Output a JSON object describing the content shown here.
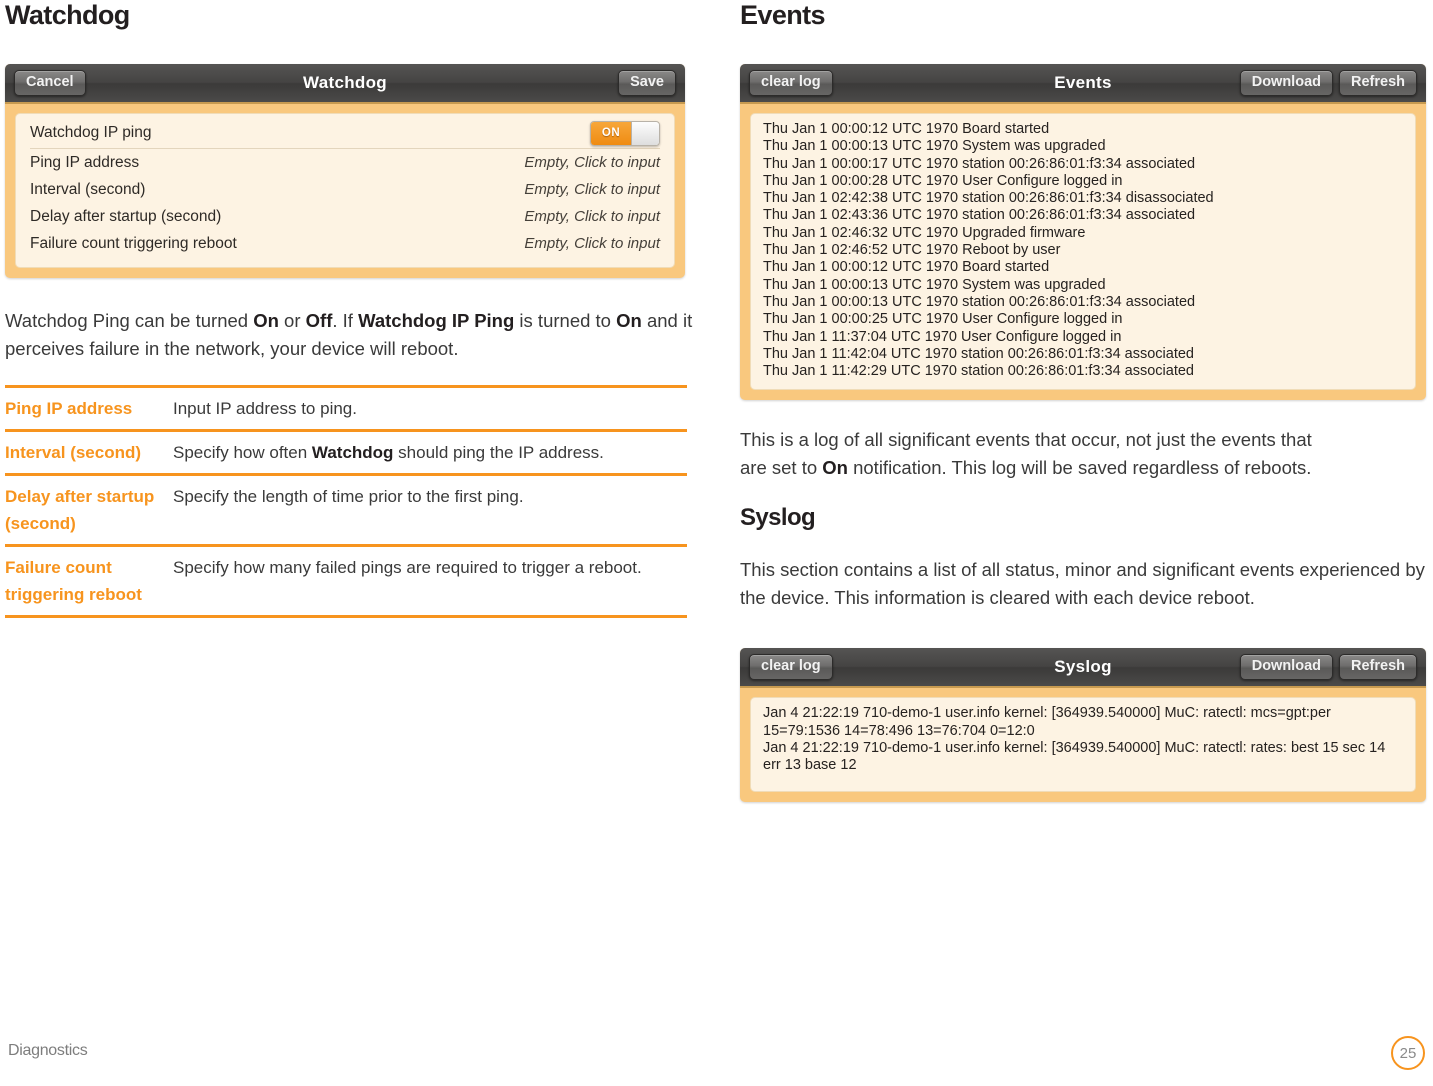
{
  "colors": {
    "accent_orange": "#F7941E",
    "panel_frame": "#F9C87E",
    "panel_content": "#FDF3E3",
    "titlebar_dark": "#454443",
    "toggle_on": "#EF8B12"
  },
  "left": {
    "heading": "Watchdog",
    "panel": {
      "cancel_label": "Cancel",
      "title": "Watchdog",
      "save_label": "Save",
      "toggle_row": {
        "label": "Watchdog IP ping",
        "toggle_state": "ON"
      },
      "rows": [
        {
          "label": "Ping IP address",
          "value": "Empty, Click to input"
        },
        {
          "label": "Interval (second)",
          "value": "Empty, Click to input"
        },
        {
          "label": "Delay after startup (second)",
          "value": "Empty, Click to input"
        },
        {
          "label": "Failure count triggering reboot",
          "value": "Empty, Click to input"
        }
      ]
    },
    "paragraph": {
      "p1": "Watchdog Ping can be turned ",
      "b1": "On",
      "p2": " or ",
      "b2": "Off",
      "p3": ". If ",
      "b3": "Watchdog IP Ping",
      "p4": " is turned to ",
      "b4": "On",
      "p5": " and it perceives failure in the network, your device will reboot."
    },
    "table": {
      "rows": [
        {
          "term": "Ping IP address",
          "def_pre": "Input IP address to ping.",
          "def_bold": "",
          "def_post": ""
        },
        {
          "term": "Interval (second)",
          "def_pre": "Specify how often ",
          "def_bold": "Watchdog",
          "def_post": " should ping the IP address."
        },
        {
          "term": "Delay after startup (second)",
          "def_pre": "Specify the length of time prior to the first ping.",
          "def_bold": "",
          "def_post": ""
        },
        {
          "term": "Failure count triggering reboot",
          "def_pre": "Specify how many failed pings are required to trigger a reboot.",
          "def_bold": "",
          "def_post": ""
        }
      ]
    }
  },
  "right": {
    "heading": "Events",
    "events_panel": {
      "clear_label": "clear log",
      "title": "Events",
      "download_label": "Download",
      "refresh_label": "Refresh",
      "lines": [
        "Thu Jan 1 00:00:12 UTC 1970 Board started",
        "Thu Jan 1 00:00:13 UTC 1970 System was upgraded",
        "Thu Jan 1 00:00:17 UTC 1970 station 00:26:86:01:f3:34 associated",
        "Thu Jan 1 00:00:28 UTC 1970 User Configure logged in",
        "Thu Jan 1 02:42:38 UTC 1970 station 00:26:86:01:f3:34 disassociated",
        "Thu Jan 1 02:43:36 UTC 1970 station 00:26:86:01:f3:34 associated",
        "Thu Jan 1 02:46:32 UTC 1970 Upgraded firmware",
        "Thu Jan 1 02:46:52 UTC 1970 Reboot by user",
        "Thu Jan 1 00:00:12 UTC 1970 Board started",
        "Thu Jan 1 00:00:13 UTC 1970 System was upgraded",
        "Thu Jan 1 00:00:13 UTC 1970 station 00:26:86:01:f3:34 associated",
        "Thu Jan 1 00:00:25 UTC 1970 User Configure logged in",
        "Thu Jan 1 11:37:04 UTC 1970 User Configure logged in",
        "Thu Jan 1 11:42:04 UTC 1970 station 00:26:86:01:f3:34 associated",
        "Thu Jan 1 11:42:29 UTC 1970 station 00:26:86:01:f3:34 associated"
      ]
    },
    "events_paragraph": {
      "p1": "This is a log of all significant events that occur, not just the events that are set to ",
      "b1": "On",
      "p2": " notification. This log will be saved regardless of reboots."
    },
    "syslog_heading": "Syslog",
    "syslog_paragraph": "This section contains a list of all status, minor and significant events experienced by the device. This information is cleared with each device reboot.",
    "syslog_panel": {
      "clear_label": "clear log",
      "title": "Syslog",
      "download_label": "Download",
      "refresh_label": "Refresh",
      "lines": [
        "Jan 4 21:22:19 710-demo-1 user.info kernel: [364939.540000] MuC: ratectl: mcs=gpt:per 15=79:1536 14=78:496 13=76:704 0=12:0",
        "Jan 4 21:22:19 710-demo-1 user.info kernel: [364939.540000] MuC: ratectl: rates: best 15 sec 14 err 13 base 12"
      ]
    }
  },
  "footer": {
    "label": "Diagnostics",
    "page_number": "25"
  }
}
